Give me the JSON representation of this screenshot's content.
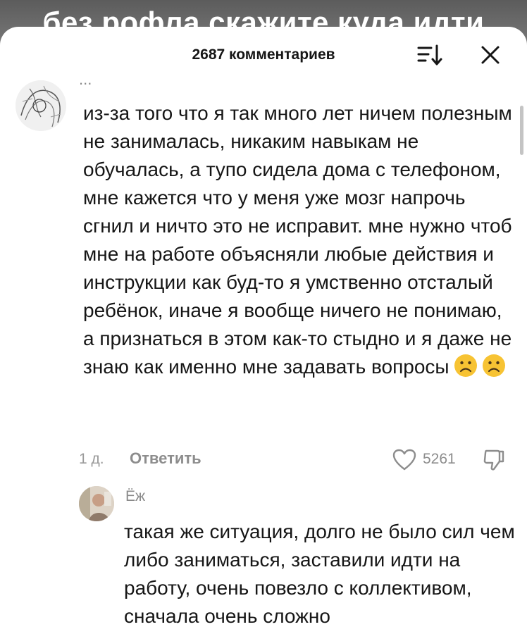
{
  "video": {
    "caption": "без рофла скажите куда идти"
  },
  "header": {
    "comments_count": "2687 комментариев",
    "sort_icon": "sort-icon",
    "close_icon": "close-icon"
  },
  "comment": {
    "ellipsis": "...",
    "text": "из-за того что я так много лет ничем полезным не занималась, никаким навыкам не обучалась, а тупо сидела дома с телефоном, мне кажется что у меня уже мозг напрочь сгнил и ничто это не исправит. мне нужно чтоб мне на работе объясняли любые действия и инструкции как буд-то я умственно отсталый ребёнок, иначе я вообще ничего не понимаю, а признаться в этом как-то стыдно и я даже не знаю как именно мне задавать вопросы",
    "emojis": [
      "frowning-face-emoji",
      "frowning-face-emoji"
    ],
    "time": "1 д.",
    "reply_label": "Ответить",
    "likes": "5261",
    "like_icon": "heart-icon",
    "dislike_icon": "thumbs-down-icon"
  },
  "reply": {
    "author": "Ёж",
    "text": "такая же ситуация, долго не было сил чем либо заниматься, заставили идти на работу, очень повезло с коллективом, сначала очень сложно"
  },
  "colors": {
    "text": "#161616",
    "muted": "#8d8d8d",
    "emoji": "#f7c333",
    "sheet": "#ffffff"
  }
}
